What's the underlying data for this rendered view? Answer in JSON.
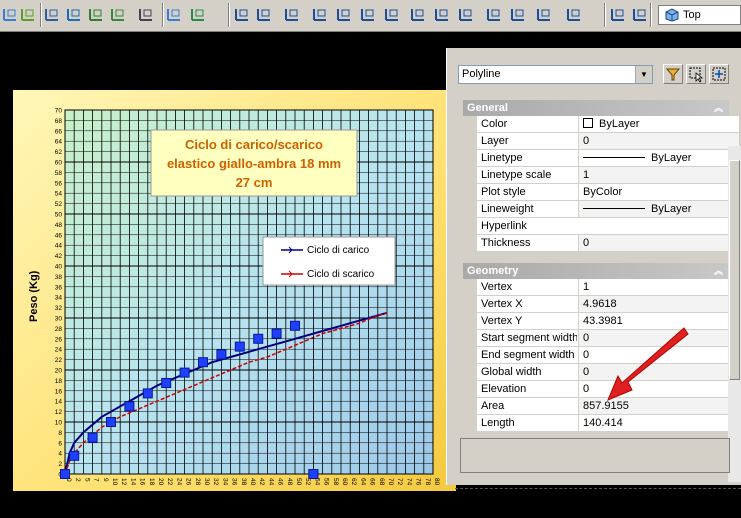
{
  "toolbar": {
    "view_value": "Top",
    "icons": [
      "draw-order-icon",
      "toolbar-icon",
      "layers-icon",
      "render-icon",
      "light-icon",
      "material-icon",
      "list-icon",
      "open-icon",
      "globe-icon",
      "ucs-icon",
      "ucs-world-icon",
      "ucs-previous-icon",
      "ucs-object-icon",
      "ucs-face-icon",
      "ucs-view-icon",
      "ucs-origin-icon",
      "ucs-zaxis-icon",
      "ucs-3point-icon",
      "ucs-x-icon",
      "ucs-y-icon",
      "ucs-z-icon",
      "ucs-apply-icon",
      "ucs-settings-icon",
      "view-icon",
      "named-view-icon"
    ]
  },
  "chart": {
    "title_lines": [
      "Ciclo di carico/scarico",
      "elastico giallo-ambra 18 mm",
      "27 cm"
    ],
    "legend": [
      "Ciclo di carico",
      "Ciclo di scarico"
    ]
  },
  "chart_data": {
    "type": "line",
    "title": "Ciclo di carico/scarico elastico giallo-ambra 18 mm 27 cm",
    "ylabel": "Peso (Kg)",
    "xlabel": "",
    "ylim": [
      0,
      70
    ],
    "yticks": [
      0,
      2,
      4,
      6,
      8,
      10,
      12,
      14,
      16,
      18,
      20,
      22,
      24,
      26,
      28,
      30,
      32,
      34,
      36,
      38,
      40,
      42,
      44,
      46,
      48,
      50,
      52,
      54,
      56,
      58,
      60,
      62,
      64,
      66,
      68,
      70
    ],
    "x_tick_labels": [
      "0",
      "2",
      "5",
      "7",
      "9",
      "10",
      "12",
      "14",
      "16",
      "18",
      "20",
      "22",
      "24",
      "26",
      "28",
      "30",
      "32",
      "34",
      "36",
      "38",
      "40",
      "42",
      "44",
      "46",
      "48",
      "50",
      "52",
      "54",
      "56",
      "58",
      "60",
      "62",
      "64",
      "66",
      "68",
      "70",
      "72",
      "74",
      "76",
      "78",
      "80"
    ],
    "legend_position": "top-right",
    "grid": true,
    "series": [
      {
        "name": "Ciclo di carico",
        "color": "#000080",
        "x": [
          0,
          1,
          2,
          4,
          8,
          12,
          16,
          20,
          24,
          28,
          32,
          36,
          40,
          44,
          48,
          52,
          56,
          60,
          64,
          68,
          70
        ],
        "y": [
          0,
          4,
          6,
          8,
          11,
          13,
          15,
          17,
          18.5,
          20,
          21.5,
          22.5,
          23.5,
          24.5,
          25.5,
          26.5,
          27.5,
          28.5,
          29.5,
          30.5,
          31
        ]
      },
      {
        "name": "Ciclo di scarico",
        "color": "#cc0000",
        "x": [
          0,
          1,
          2,
          4,
          8,
          12,
          16,
          20,
          24,
          28,
          32,
          36,
          40,
          44,
          48,
          52,
          56,
          60,
          64,
          68,
          70
        ],
        "y": [
          0,
          2.5,
          4,
          6,
          9,
          11,
          12.5,
          14,
          15.5,
          17,
          18.5,
          20,
          21.5,
          22.5,
          24,
          25.5,
          27,
          28,
          29,
          30.5,
          31
        ]
      }
    ],
    "markers": {
      "x": [
        0,
        2,
        6,
        10,
        14,
        18,
        22,
        26,
        30,
        34,
        38,
        42,
        46,
        50,
        54,
        54
      ],
      "y": [
        0,
        3.5,
        7,
        10,
        13,
        15.5,
        17.5,
        19.5,
        21.5,
        23,
        24.5,
        26,
        27,
        28.5,
        0,
        0
      ]
    }
  },
  "panel": {
    "selector": "Polyline",
    "groups": [
      {
        "title": "General",
        "rows": [
          {
            "key": "Color",
            "value": "ByLayer",
            "swatch": true
          },
          {
            "key": "Layer",
            "value": "0"
          },
          {
            "key": "Linetype",
            "value": "ByLayer",
            "line": true
          },
          {
            "key": "Linetype scale",
            "value": "1"
          },
          {
            "key": "Plot style",
            "value": "ByColor"
          },
          {
            "key": "Lineweight",
            "value": "ByLayer",
            "line": true
          },
          {
            "key": "Hyperlink",
            "value": ""
          },
          {
            "key": "Thickness",
            "value": "0"
          }
        ]
      },
      {
        "title": "Geometry",
        "rows": [
          {
            "key": "Vertex",
            "value": "1"
          },
          {
            "key": "Vertex X",
            "value": "4.9618"
          },
          {
            "key": "Vertex Y",
            "value": "43.3981"
          },
          {
            "key": "Start segment width",
            "value": "0"
          },
          {
            "key": "End segment width",
            "value": "0"
          },
          {
            "key": "Global width",
            "value": "0"
          },
          {
            "key": "Elevation",
            "value": "0"
          },
          {
            "key": "Area",
            "value": "857.9155"
          },
          {
            "key": "Length",
            "value": "140.414"
          }
        ]
      }
    ]
  },
  "colors": {
    "annotation_arrow": "#e02020"
  }
}
